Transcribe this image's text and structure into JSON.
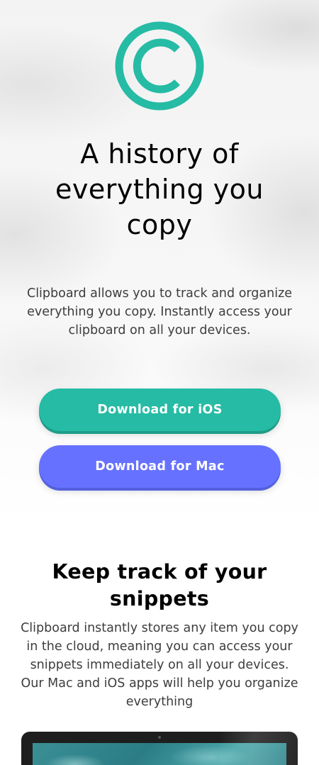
{
  "hero": {
    "title": "A history of everything you copy",
    "text": "Clipboard allows you to track and organize everything you copy. Instantly access your clipboard on all your devices."
  },
  "buttons": {
    "ios_label": "Download for iOS",
    "mac_label": "Download for Mac"
  },
  "snippets": {
    "title": "Keep track of your snippets",
    "text": "Clipboard instantly stores any item you copy in the cloud, meaning you can access your snippets immediately on all your devices. Our Mac and iOS apps will help you organize everything"
  },
  "colors": {
    "accent_teal": "#26bba4",
    "accent_blue": "#6672ff",
    "heading": "#000000",
    "body_text": "#3d3d3d"
  },
  "icons": {
    "logo": "copyright-circle-icon"
  }
}
